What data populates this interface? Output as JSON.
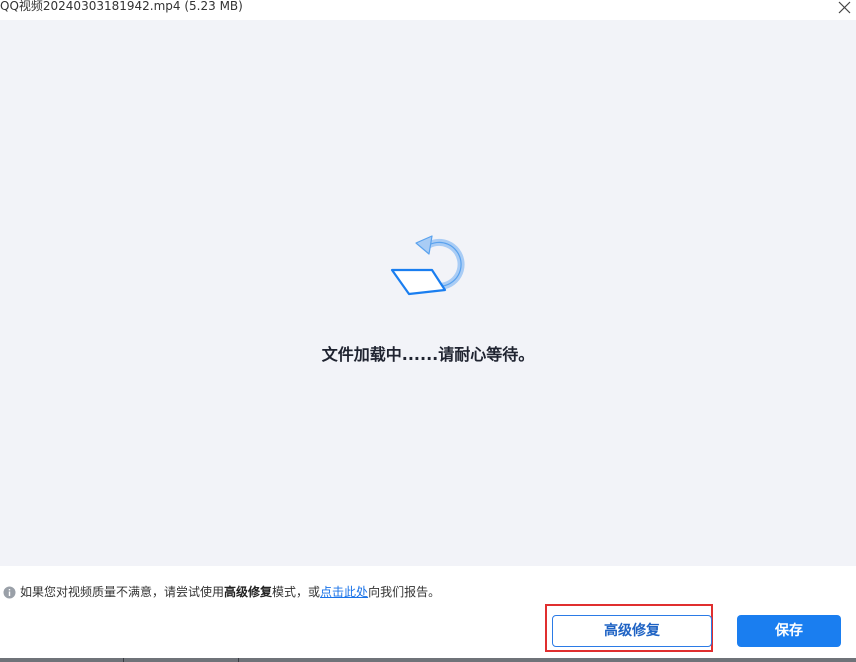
{
  "window": {
    "title": "QQ视频20240303181942.mp4 (5.23  MB)",
    "close_icon": "close-icon"
  },
  "preview": {
    "loading_icon": "rotate-refresh-icon",
    "loading_text": "文件加载中......请耐心等待。"
  },
  "info": {
    "icon": "info-icon",
    "text_before": "如果您对视频质量不满意，请尝试使用",
    "bold_text": "高级修复",
    "text_middle": "模式，或",
    "link_text": "点击此处",
    "text_after": "向我们报告。"
  },
  "buttons": {
    "advanced_repair": "高级修复",
    "save": "保存"
  },
  "colors": {
    "preview_bg": "#f2f3f8",
    "accent": "#1a7ef0",
    "highlight": "#e02f2f",
    "link": "#1a73e8"
  }
}
